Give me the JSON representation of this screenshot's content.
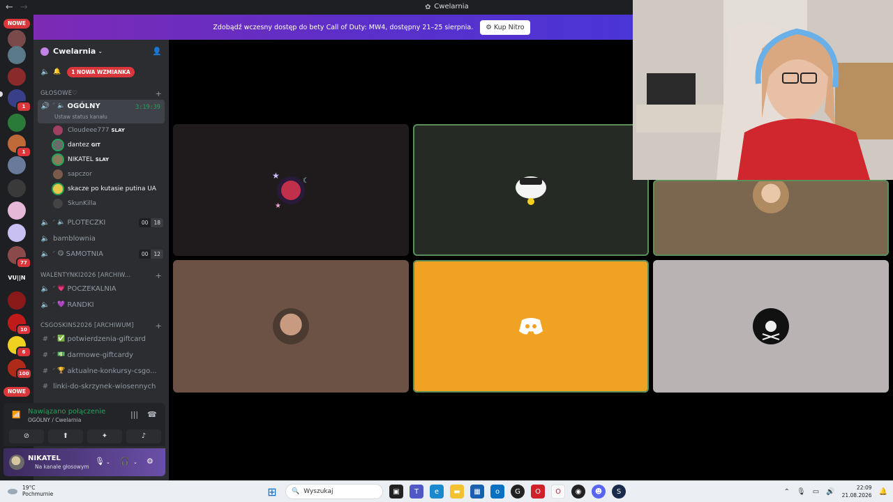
{
  "window": {
    "title": "Cwelarnia",
    "back_glyph": "←",
    "forward_glyph": "→"
  },
  "rail": {
    "top_pill": "NOWE",
    "bottom_pill": "NOWE",
    "badges": [
      "1",
      "1",
      "77",
      "6",
      "10",
      "100"
    ],
    "text_server": "VU||N"
  },
  "banner": {
    "text": "Zdobądź wczesny dostęp do bety Call of Duty: MW4, dostępny 21–25 sierpnia.",
    "button": "Kup Nitro"
  },
  "server": {
    "name": "Cwelarnia"
  },
  "channels": {
    "mention_pill": "1 NOWA WZMIANKA",
    "cat_voice": "GŁOSOWE♡",
    "active": {
      "name": "OGÓLNY",
      "timer": "3:19:39",
      "status": "Ustaw status kanału"
    },
    "users": [
      {
        "name": "Cloudeee777",
        "tag": "SLAY",
        "color": "#a04060"
      },
      {
        "name": "dantez",
        "tag": "GIT",
        "color": "#6a6a6a"
      },
      {
        "name": "NIKATEL",
        "tag": "SLAY",
        "color": "#8a7a5a"
      },
      {
        "name": "sapczor",
        "tag": "",
        "color": "#7a5a4a"
      },
      {
        "name": "skacze po kutasie putina UA",
        "tag": "",
        "color": "#e8c84a"
      },
      {
        "name": "SkunKilla",
        "tag": "",
        "color": "#444"
      }
    ],
    "ploteczki": {
      "name": "PLOTECZKI",
      "a": "00",
      "b": "18"
    },
    "bamblownia": "bamblownia",
    "samotnia": {
      "name": "SAMOTNIA",
      "a": "00",
      "b": "12"
    },
    "cat_walentynki": "WALENTYNKI2026 [ARCHIW...",
    "poczekalnia": "POCZEKALNIA",
    "randki": "RANDKI",
    "cat_csgo": "CSGOSKINS2026 [ARCHIWUM]",
    "text_channels": [
      "potwierdzenia-giftcard",
      "darmowe-giftcardy",
      "aktualne-konkursy-csgo...",
      "linki-do-skrzynek-wiosennych"
    ]
  },
  "voice_panel": {
    "status": "Nawiązano połączenie",
    "location": "OGÓLNY / Cwelarnia"
  },
  "user_panel": {
    "name": "NIKATEL",
    "status": "Na kanale głosowym"
  },
  "taskbar": {
    "temp": "19°C",
    "weather": "Pochmurnie",
    "search": "Wyszukaj",
    "time": "22:09",
    "date": "21.08.2026"
  },
  "colors": {
    "accent_green": "#23a559",
    "mention_red": "#da373c",
    "orange_tile": "#f0a322"
  }
}
